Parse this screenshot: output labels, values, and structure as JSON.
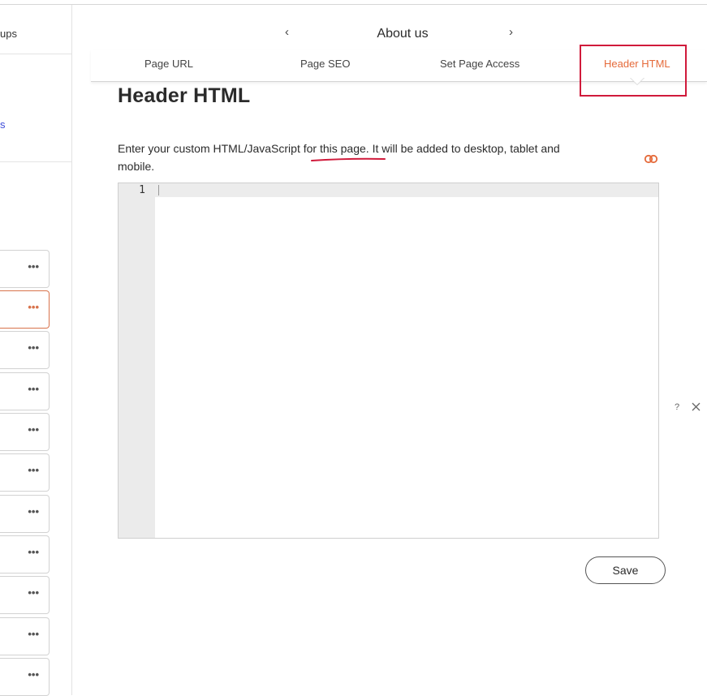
{
  "sidebar": {
    "groups_label": "ups",
    "link_label": "s",
    "item_menu": "•••"
  },
  "page_nav": {
    "page_name": "About us",
    "prev_symbol": "‹",
    "next_symbol": "›"
  },
  "tabs": [
    {
      "label": "Page URL"
    },
    {
      "label": "Page SEO"
    },
    {
      "label": "Set Page Access"
    },
    {
      "label": "Header HTML",
      "active": true
    }
  ],
  "section": {
    "title": "Header HTML",
    "description": "Enter your custom HTML/JavaScript for this page. It will be added to desktop, tablet and mobile."
  },
  "editor": {
    "line_number": "1"
  },
  "actions": {
    "save_label": "Save",
    "help_label": "?"
  },
  "colors": {
    "accent": "#e56a3a",
    "highlight": "#d01a3b",
    "link": "#3d4bd9"
  }
}
